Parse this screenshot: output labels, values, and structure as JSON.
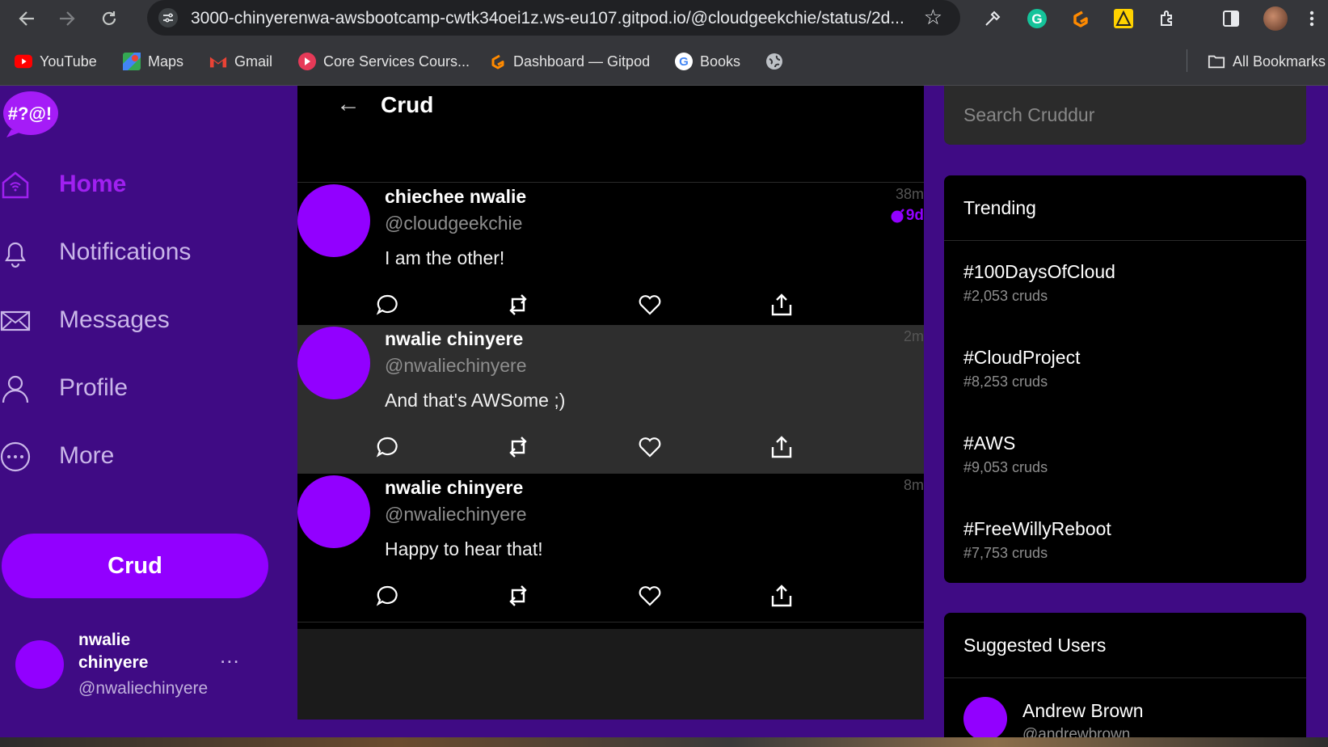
{
  "browser": {
    "url": "3000-chinyerenwa-awsbootcamp-cwtk34oei1z.ws-eu107.gitpod.io/@cloudgeekchie/status/2d...",
    "bookmarks": [
      {
        "label": "YouTube",
        "icon": "youtube-icon"
      },
      {
        "label": "Maps",
        "icon": "maps-icon"
      },
      {
        "label": "Gmail",
        "icon": "gmail-icon"
      },
      {
        "label": "Core Services Cours...",
        "icon": "course-icon"
      },
      {
        "label": "Dashboard — Gitpod",
        "icon": "gitpod-icon"
      },
      {
        "label": "Books",
        "icon": "google-icon"
      },
      {
        "label": "",
        "icon": "globe-icon"
      }
    ],
    "all_bookmarks_label": "All Bookmarks"
  },
  "app": {
    "logo_text": "#?@!",
    "nav": [
      {
        "label": "Home",
        "icon": "home-icon",
        "active": true
      },
      {
        "label": "Notifications",
        "icon": "bell-icon",
        "active": false
      },
      {
        "label": "Messages",
        "icon": "envelope-icon",
        "active": false
      },
      {
        "label": "Profile",
        "icon": "person-icon",
        "active": false
      },
      {
        "label": "More",
        "icon": "more-circle-icon",
        "active": false
      }
    ],
    "crud_button": "Crud",
    "current_user": {
      "name": "nwalie chinyere",
      "handle": "@nwaliechinyere",
      "more": "..."
    }
  },
  "main": {
    "back": "←",
    "title": "Crud",
    "activities": [
      {
        "name": "chiechee nwalie",
        "handle": "@cloudgeekchie",
        "message": "I am the other!",
        "time": "38m",
        "expires": "9d"
      },
      {
        "name": "nwalie chinyere",
        "handle": "@nwaliechinyere",
        "message": "And that's AWSome ;)",
        "time": "2m"
      },
      {
        "name": "nwalie chinyere",
        "handle": "@nwaliechinyere",
        "message": "Happy to hear that!",
        "time": "8m"
      }
    ]
  },
  "sidebar": {
    "search_placeholder": "Search Cruddur",
    "trending_title": "Trending",
    "trends": [
      {
        "tag": "#100DaysOfCloud",
        "count": "#2,053 cruds"
      },
      {
        "tag": "#CloudProject",
        "count": "#8,253 cruds"
      },
      {
        "tag": "#AWS",
        "count": "#9,053 cruds"
      },
      {
        "tag": "#FreeWillyReboot",
        "count": "#7,753 cruds"
      }
    ],
    "suggested_title": "Suggested Users",
    "suggested": [
      {
        "name": "Andrew Brown",
        "handle": "@andrewbrown"
      }
    ]
  },
  "colors": {
    "accent": "#9200ff",
    "sidebar_bg": "#3f0b84",
    "main_bg": "#000000"
  }
}
